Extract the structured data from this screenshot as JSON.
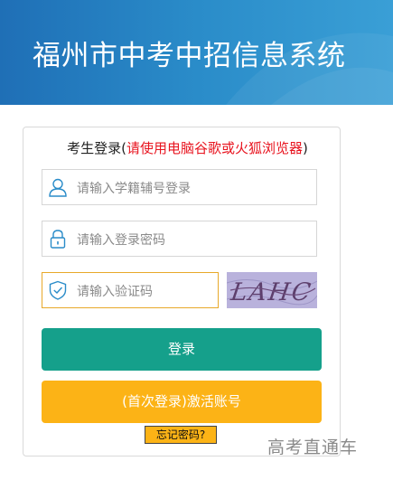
{
  "header": {
    "title": "福州市中考中招信息系统"
  },
  "login": {
    "title_prefix": "考生登录(",
    "title_warning": "请使用电脑谷歌或火狐浏览器",
    "title_suffix": ")",
    "username_placeholder": "请输入学籍辅号登录",
    "password_placeholder": "请输入登录密码",
    "captcha_placeholder": "请输入验证码",
    "captcha_text": "LAHC",
    "login_button": "登录",
    "activate_button": "(首次登录)激活账号",
    "forgot_link": "忘记密码?"
  },
  "watermark": {
    "text": "高考直通车"
  },
  "colors": {
    "header_blue": "#2a8cc9",
    "login_green": "#15a08b",
    "activate_yellow": "#fcb316",
    "warning_red": "#e8141f",
    "icon_blue": "#2a8cc9"
  },
  "icons": {
    "username": "user-icon",
    "password": "lock-icon",
    "captcha": "shield-check-icon"
  }
}
